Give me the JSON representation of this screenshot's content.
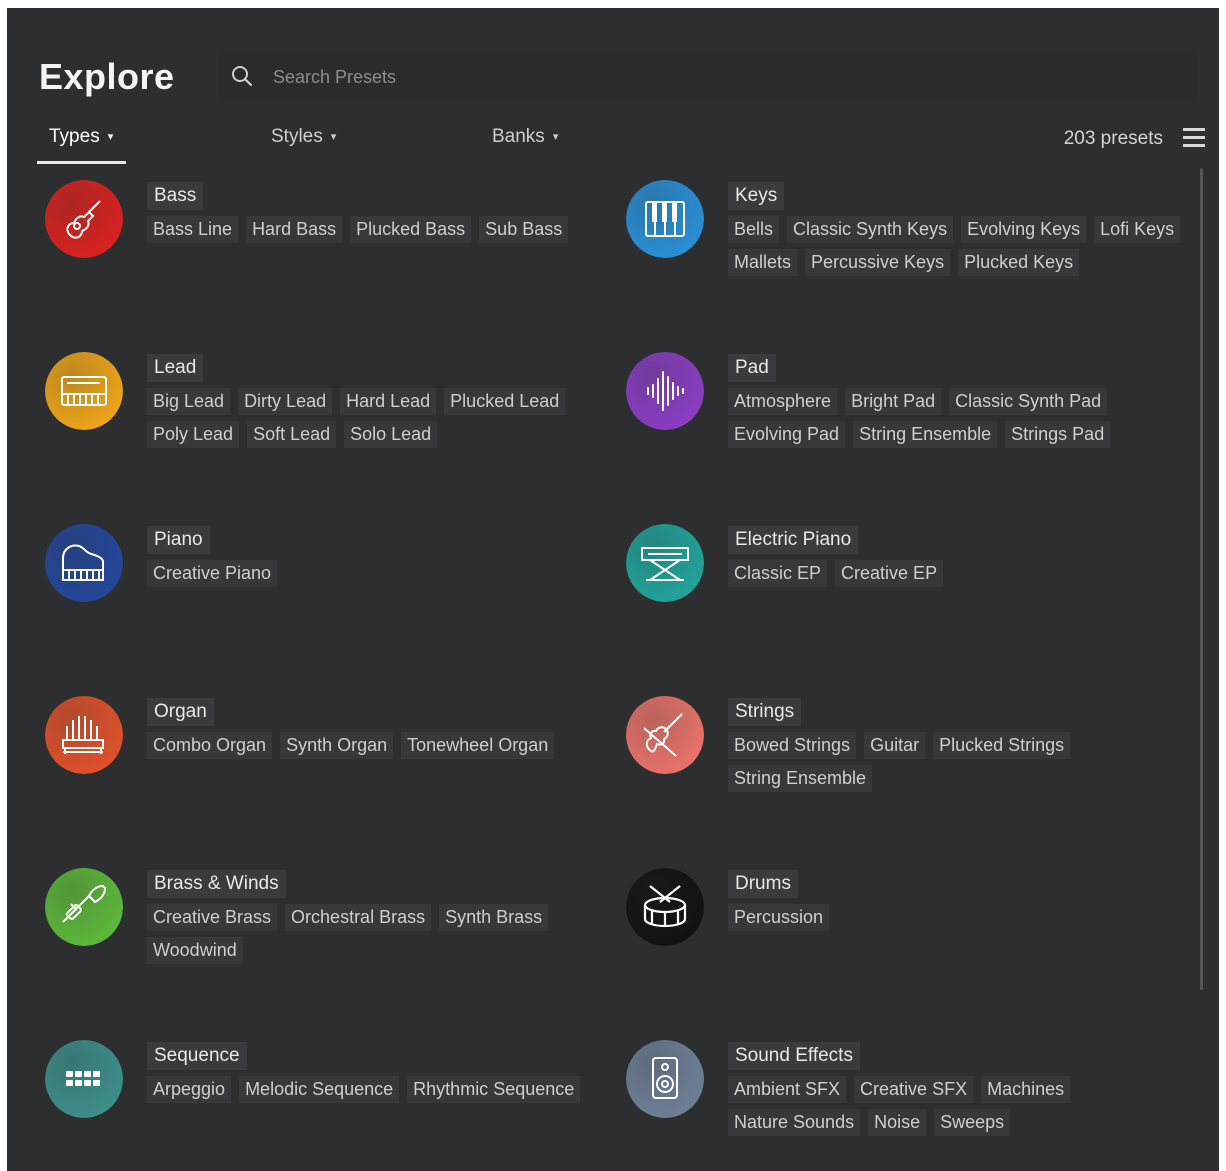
{
  "header": {
    "title": "Explore",
    "search_placeholder": "Search Presets"
  },
  "filters": {
    "tabs": [
      {
        "label": "Types"
      },
      {
        "label": "Styles"
      },
      {
        "label": "Banks"
      }
    ],
    "caret": "▾",
    "preset_count": "203 presets"
  },
  "colors": {
    "bass": "#d8221f",
    "keys": "#2a8fd6",
    "lead": "#eda51a",
    "pad": "#8a3ec2",
    "piano": "#24479a",
    "electric_piano": "#21a39a",
    "organ": "#e0512a",
    "strings": "#e8736a",
    "brass_winds": "#5db83a",
    "drums": "#111214",
    "sequence": "#3d8e8a",
    "sound_effects": "#6e7f96"
  },
  "categories": [
    {
      "name": "Bass",
      "icon": "guitar-icon",
      "tags": [
        "Bass Line",
        "Hard Bass",
        "Plucked Bass",
        "Sub Bass"
      ]
    },
    {
      "name": "Keys",
      "icon": "keyboard-keys-icon",
      "tags": [
        "Bells",
        "Classic Synth Keys",
        "Evolving Keys",
        "Lofi Keys",
        "Mallets",
        "Percussive Keys",
        "Plucked Keys"
      ]
    },
    {
      "name": "Lead",
      "icon": "synth-icon",
      "tags": [
        "Big Lead",
        "Dirty Lead",
        "Hard Lead",
        "Plucked Lead",
        "Poly Lead",
        "Soft Lead",
        "Solo Lead"
      ]
    },
    {
      "name": "Pad",
      "icon": "waveform-icon",
      "tags": [
        "Atmosphere",
        "Bright Pad",
        "Classic Synth Pad",
        "Evolving Pad",
        "String Ensemble",
        "Strings Pad"
      ]
    },
    {
      "name": "Piano",
      "icon": "grand-piano-icon",
      "tags": [
        "Creative Piano"
      ]
    },
    {
      "name": "Electric Piano",
      "icon": "electric-piano-icon",
      "tags": [
        "Classic EP",
        "Creative EP"
      ]
    },
    {
      "name": "Organ",
      "icon": "organ-icon",
      "tags": [
        "Combo Organ",
        "Synth Organ",
        "Tonewheel Organ"
      ]
    },
    {
      "name": "Strings",
      "icon": "violin-icon",
      "tags": [
        "Bowed Strings",
        "Guitar",
        "Plucked Strings",
        "String Ensemble"
      ]
    },
    {
      "name": "Brass & Winds",
      "icon": "trumpet-icon",
      "tags": [
        "Creative Brass",
        "Orchestral Brass",
        "Synth Brass",
        "Woodwind"
      ]
    },
    {
      "name": "Drums",
      "icon": "drum-icon",
      "tags": [
        "Percussion"
      ]
    },
    {
      "name": "Sequence",
      "icon": "sequencer-grid-icon",
      "tags": [
        "Arpeggio",
        "Melodic Sequence",
        "Rhythmic Sequence"
      ]
    },
    {
      "name": "Sound Effects",
      "icon": "speaker-icon",
      "tags": [
        "Ambient SFX",
        "Creative SFX",
        "Machines",
        "Nature Sounds",
        "Noise",
        "Sweeps"
      ]
    }
  ]
}
